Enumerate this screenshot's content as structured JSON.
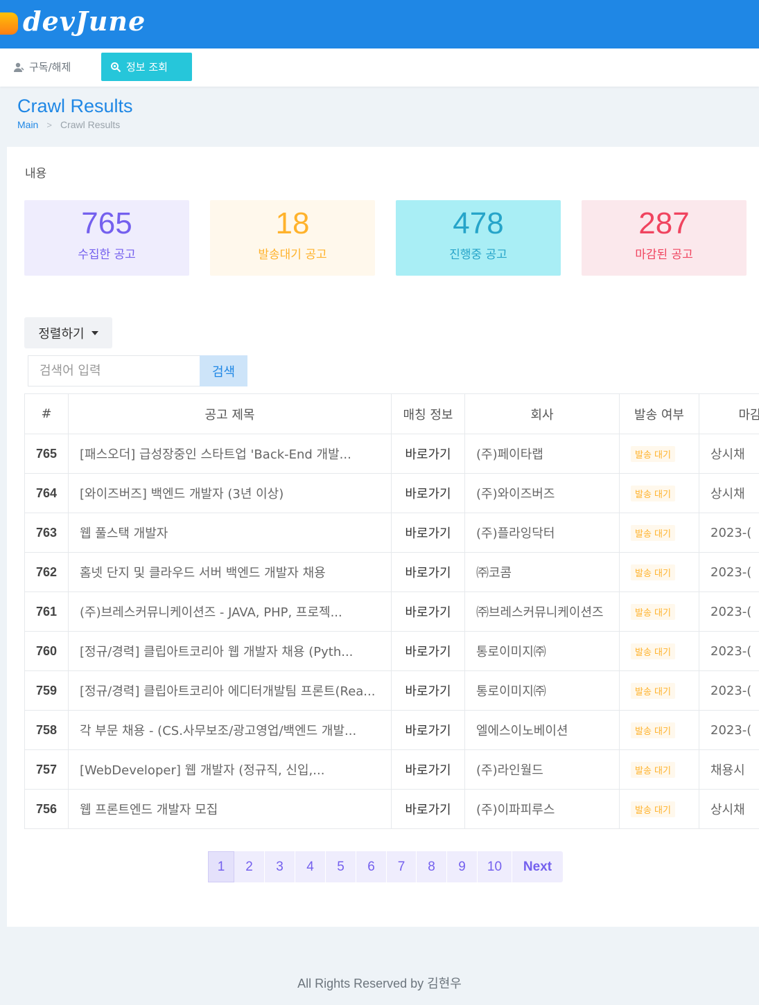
{
  "brand": {
    "name": "devJune"
  },
  "nav": {
    "items": [
      {
        "label": "구독/해제",
        "icon": "user-icon"
      },
      {
        "label": "정보 조회",
        "icon": "search-icon"
      }
    ]
  },
  "page": {
    "title": "Crawl Results"
  },
  "breadcrumb": {
    "home": "Main",
    "separator": ">",
    "current": "Crawl Results"
  },
  "card": {
    "title": "내용"
  },
  "stats": [
    {
      "value": "765",
      "label": "수집한 공고",
      "color": "#7460ee"
    },
    {
      "value": "18",
      "label": "발송대기 공고",
      "color": "#ffb22b"
    },
    {
      "value": "478",
      "label": "진행중 공고",
      "color": "#26a4c9"
    },
    {
      "value": "287",
      "label": "마감된 공고",
      "color": "#f0445f"
    }
  ],
  "sort": {
    "label": "정렬하기"
  },
  "search": {
    "placeholder": "검색어 입력",
    "button": "검색"
  },
  "table": {
    "headers": [
      "#",
      "공고 제목",
      "매칭 정보",
      "회사",
      "발송 여부",
      "마감"
    ],
    "rows": [
      {
        "id": "765",
        "title": "[패스오더] 급성장중인 스타트업 'Back-End 개발...",
        "link": "바로가기",
        "company": "(주)페이타랩",
        "status": "발송 대기",
        "deadline": "상시채"
      },
      {
        "id": "764",
        "title": "[와이즈버즈] 백엔드 개발자 (3년 이상)",
        "link": "바로가기",
        "company": "(주)와이즈버즈",
        "status": "발송 대기",
        "deadline": "상시채"
      },
      {
        "id": "763",
        "title": "웹 풀스택 개발자",
        "link": "바로가기",
        "company": "(주)플라잉닥터",
        "status": "발송 대기",
        "deadline": "2023-("
      },
      {
        "id": "762",
        "title": "홈넷 단지 및 클라우드 서버 백엔드 개발자 채용",
        "link": "바로가기",
        "company": "㈜코콤",
        "status": "발송 대기",
        "deadline": "2023-("
      },
      {
        "id": "761",
        "title": "(주)브레스커뮤니케이션즈 - JAVA, PHP, 프로젝...",
        "link": "바로가기",
        "company": "㈜브레스커뮤니케이션즈",
        "status": "발송 대기",
        "deadline": "2023-("
      },
      {
        "id": "760",
        "title": "[정규/경력] 클립아트코리아 웹 개발자 채용 (Pyth...",
        "link": "바로가기",
        "company": "통로이미지㈜",
        "status": "발송 대기",
        "deadline": "2023-("
      },
      {
        "id": "759",
        "title": "[정규/경력] 클립아트코리아 에디터개발팀 프론트(Rea...",
        "link": "바로가기",
        "company": "통로이미지㈜",
        "status": "발송 대기",
        "deadline": "2023-("
      },
      {
        "id": "758",
        "title": "각 부문 채용 - (CS.사무보조/광고영업/백엔드 개발...",
        "link": "바로가기",
        "company": "엘에스이노베이션",
        "status": "발송 대기",
        "deadline": "2023-("
      },
      {
        "id": "757",
        "title": "[WebDeveloper] 웹 개발자 (정규직, 신입,...",
        "link": "바로가기",
        "company": "(주)라인월드",
        "status": "발송 대기",
        "deadline": "채용시"
      },
      {
        "id": "756",
        "title": "웹 프론트엔드 개발자 모집",
        "link": "바로가기",
        "company": "(주)이파피루스",
        "status": "발송 대기",
        "deadline": "상시채"
      }
    ]
  },
  "pagination": {
    "pages": [
      "1",
      "2",
      "3",
      "4",
      "5",
      "6",
      "7",
      "8",
      "9",
      "10"
    ],
    "active": "1",
    "next": "Next"
  },
  "footer": {
    "text": "All Rights Reserved by 김현우"
  }
}
